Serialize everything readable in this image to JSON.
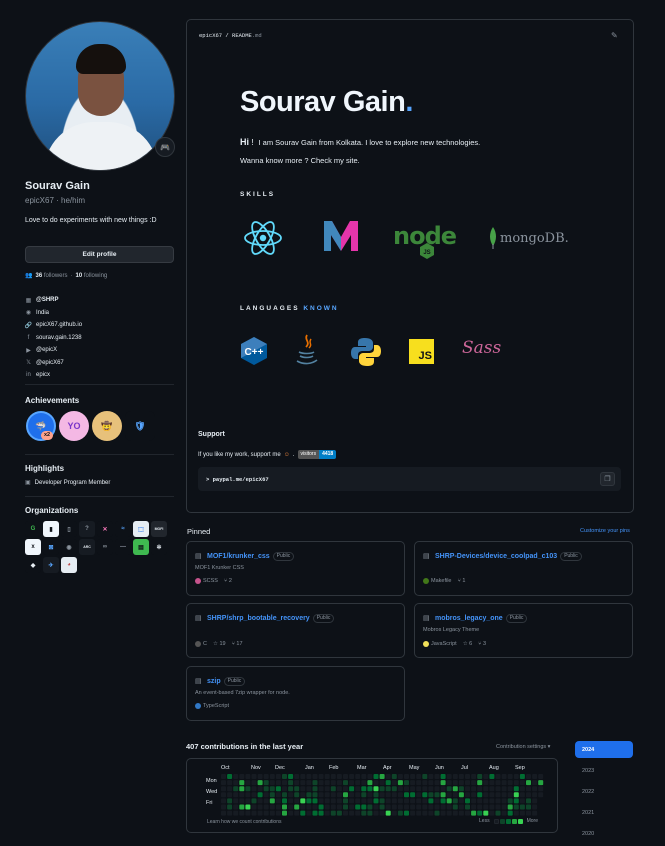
{
  "profile": {
    "name": "Sourav Gain",
    "login": "epicX67",
    "pronouns": "he/him",
    "login_line": "epicX67 · he/him",
    "bio": "Love to do experiments with new things :D",
    "edit_label": "Edit profile",
    "followers_count": "36",
    "followers_label": "followers",
    "following_count": "10",
    "following_label": "following",
    "details": [
      {
        "icon": "organization-icon",
        "text": "@SHRP",
        "bold": true
      },
      {
        "icon": "location-icon",
        "text": "India"
      },
      {
        "icon": "link-icon",
        "text": "epicX67.github.io"
      },
      {
        "icon": "facebook-icon",
        "text": "sourav.gain.1238"
      },
      {
        "icon": "youtube-icon",
        "text": "@epicX"
      },
      {
        "icon": "x-icon",
        "text": "@epicX67"
      },
      {
        "icon": "linkedin-icon",
        "text": "epicx"
      }
    ]
  },
  "achievements": {
    "title": "Achievements",
    "items": [
      {
        "name": "pull-shark",
        "color": "#2f81f7"
      },
      {
        "name": "yolo",
        "color": "#e9b7f5"
      },
      {
        "name": "quickdraw",
        "color": "#f0c879"
      },
      {
        "name": "pair-extraordinaire",
        "color": "#1f6feb"
      }
    ],
    "badge_count": "x2"
  },
  "highlights": {
    "title": "Highlights",
    "item": "Developer Program Member"
  },
  "organizations": {
    "title": "Organizations",
    "items": [
      {
        "text": "G",
        "bg": "#0d1117",
        "fg": "#3fb950"
      },
      {
        "text": "▮",
        "bg": "#f0f6fc",
        "fg": "#0d1117"
      },
      {
        "text": "▯",
        "bg": "#0d1117",
        "fg": "#8b949e"
      },
      {
        "text": "?",
        "bg": "#161b22",
        "fg": "#8b949e"
      },
      {
        "text": "✕",
        "bg": "#0d1117",
        "fg": "#f778ba"
      },
      {
        "text": "≈",
        "bg": "#0d1117",
        "fg": "#58a6ff"
      },
      {
        "text": "⬚",
        "bg": "#e6edf3",
        "fg": "#1f6feb"
      },
      {
        "text": "MOFI",
        "bg": "#21262d",
        "fg": "#e6edf3"
      },
      {
        "text": "x",
        "bg": "#f0f6fc",
        "fg": "#0d1117"
      },
      {
        "text": "⊠",
        "bg": "#0d1117",
        "fg": "#58a6ff"
      },
      {
        "text": "◉",
        "bg": "#0d1117",
        "fg": "#8b949e"
      },
      {
        "text": "ARC",
        "bg": "#161b22",
        "fg": "#e6edf3"
      },
      {
        "text": "∞",
        "bg": "#0d1117",
        "fg": "#8b949e"
      },
      {
        "text": "—",
        "bg": "#0d1117",
        "fg": "#8b949e"
      },
      {
        "text": "▤",
        "bg": "#3fb950",
        "fg": "#0d1117"
      },
      {
        "text": "✲",
        "bg": "#0d1117",
        "fg": "#e6edf3"
      },
      {
        "text": "◆",
        "bg": "#0d1117",
        "fg": "#e6edf3"
      },
      {
        "text": "✈",
        "bg": "#161b22",
        "fg": "#58a6ff"
      },
      {
        "text": "◕",
        "bg": "#e6edf3",
        "fg": "#bf4b4b"
      }
    ]
  },
  "readme": {
    "path_owner": "epicX67",
    "path_sep": " / ",
    "path_file": "README",
    "path_ext": ".md",
    "hero_name": "Sourav Gain",
    "hero_dot": ".",
    "hi": "Hi",
    "hi_excl": "!",
    "intro": "I am Sourav Gain from Kolkata.   I love to explore new technologies.",
    "knowmore": "Wanna know more ? Check my site.",
    "skills_title": "SKILLS",
    "languages_title": "LANGUAGES",
    "languages_known": "KNOWN",
    "skills": [
      {
        "name": "react-icon",
        "color": "#61dafb"
      },
      {
        "name": "marko-icon",
        "color": "#e535ab"
      },
      {
        "name": "nodejs-icon",
        "color": "#3c873a",
        "label": "node"
      },
      {
        "name": "mongodb-icon",
        "color": "#47a248",
        "label": "mongoDB."
      }
    ],
    "languages": [
      {
        "name": "cpp-icon",
        "color": "#00599c",
        "label": "C++"
      },
      {
        "name": "java-icon",
        "color": "#e76f00"
      },
      {
        "name": "python-icon",
        "color": "#3776ab"
      },
      {
        "name": "javascript-icon",
        "color": "#f7df1e",
        "label": "JS"
      },
      {
        "name": "sass-icon",
        "color": "#cc6699",
        "label": "Sass"
      }
    ],
    "support_title": "Support",
    "support_text": "If you like my work, support me",
    "visitors_label": "visitors",
    "visitors_count": "4418",
    "command": "> paypal.me/epicX67"
  },
  "pinned": {
    "title": "Pinned",
    "customize": "Customize your pins",
    "public_label": "Public",
    "repos": [
      {
        "name": "MOF1/krunker_css",
        "desc": "MOF1 Krunker CSS",
        "lang": "SCSS",
        "color": "#c6538c",
        "stars": "",
        "forks": "2"
      },
      {
        "name": "SHRP-Devices/device_coolpad_c103",
        "desc": "",
        "lang": "Makefile",
        "color": "#427819",
        "stars": "",
        "forks": "1"
      },
      {
        "name": "SHRP/shrp_bootable_recovery",
        "desc": "",
        "lang": "C",
        "color": "#555555",
        "stars": "19",
        "forks": "17"
      },
      {
        "name": "mobros_legacy_one",
        "desc": "Mobros Legacy Theme",
        "lang": "JavaScript",
        "color": "#f1e05a",
        "stars": "6",
        "forks": "3"
      },
      {
        "name": "szip",
        "desc": "An event-based 7zip wrapper for node.",
        "lang": "TypeScript",
        "color": "#3178c6",
        "stars": "",
        "forks": ""
      }
    ]
  },
  "contributions": {
    "title": "407 contributions in the last year",
    "settings": "Contribution settings ▾",
    "months": [
      "Oct",
      "Nov",
      "Dec",
      "Jan",
      "Feb",
      "Mar",
      "Apr",
      "May",
      "Jun",
      "Jul",
      "Aug",
      "Sep"
    ],
    "days": [
      "Mon",
      "Wed",
      "Fri"
    ],
    "learn": "Learn how we count contributions",
    "less": "Less",
    "more": "More",
    "colors": [
      "#161b22",
      "#0e4429",
      "#006d32",
      "#26a641",
      "#39d353"
    ],
    "years": [
      "2024",
      "2023",
      "2022",
      "2021",
      "2020"
    ],
    "active_year": "2024"
  }
}
